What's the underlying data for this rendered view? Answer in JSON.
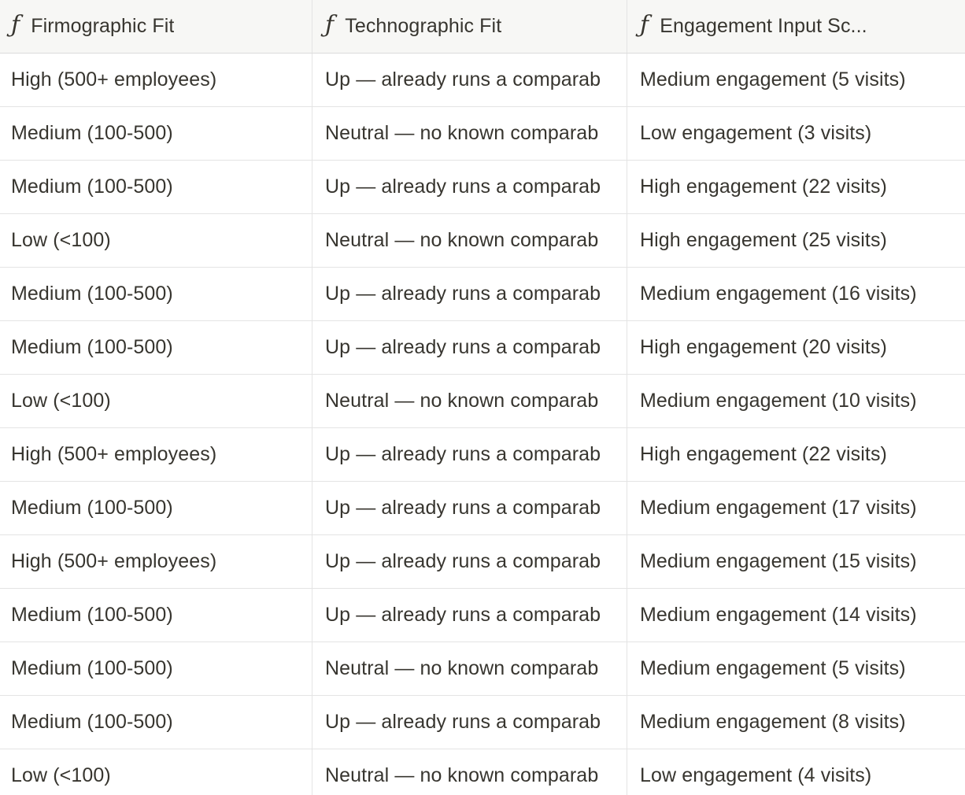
{
  "table": {
    "columns": [
      {
        "icon": "formula-icon",
        "icon_glyph": "ƒ",
        "label": "Firmographic Fit"
      },
      {
        "icon": "formula-icon",
        "icon_glyph": "ƒ",
        "label": "Technographic Fit"
      },
      {
        "icon": "formula-icon",
        "icon_glyph": "ƒ",
        "label": "Engagement Input Sc..."
      }
    ],
    "rows": [
      [
        "High (500+ employees)",
        "Up — already runs a comparab",
        "Medium engagement (5 visits)"
      ],
      [
        "Medium (100-500)",
        "Neutral — no known comparab",
        "Low engagement (3 visits)"
      ],
      [
        "Medium (100-500)",
        "Up — already runs a comparab",
        "High engagement (22 visits)"
      ],
      [
        "Low (<100)",
        "Neutral — no known comparab",
        "High engagement (25 visits)"
      ],
      [
        "Medium (100-500)",
        "Up — already runs a comparab",
        "Medium engagement (16 visits)"
      ],
      [
        "Medium (100-500)",
        "Up — already runs a comparab",
        "High engagement (20 visits)"
      ],
      [
        "Low (<100)",
        "Neutral — no known comparab",
        "Medium engagement (10 visits)"
      ],
      [
        "High (500+ employees)",
        "Up — already runs a comparab",
        "High engagement (22 visits)"
      ],
      [
        "Medium (100-500)",
        "Up — already runs a comparab",
        "Medium engagement (17 visits)"
      ],
      [
        "High (500+ employees)",
        "Up — already runs a comparab",
        "Medium engagement (15 visits)"
      ],
      [
        "Medium (100-500)",
        "Up — already runs a comparab",
        "Medium engagement (14 visits)"
      ],
      [
        "Medium (100-500)",
        "Neutral — no known comparab",
        "Medium engagement (5 visits)"
      ],
      [
        "Medium (100-500)",
        "Up — already runs a comparab",
        "Medium engagement (8 visits)"
      ],
      [
        "Low (<100)",
        "Neutral — no known comparab",
        "Low engagement (4 visits)"
      ]
    ]
  }
}
